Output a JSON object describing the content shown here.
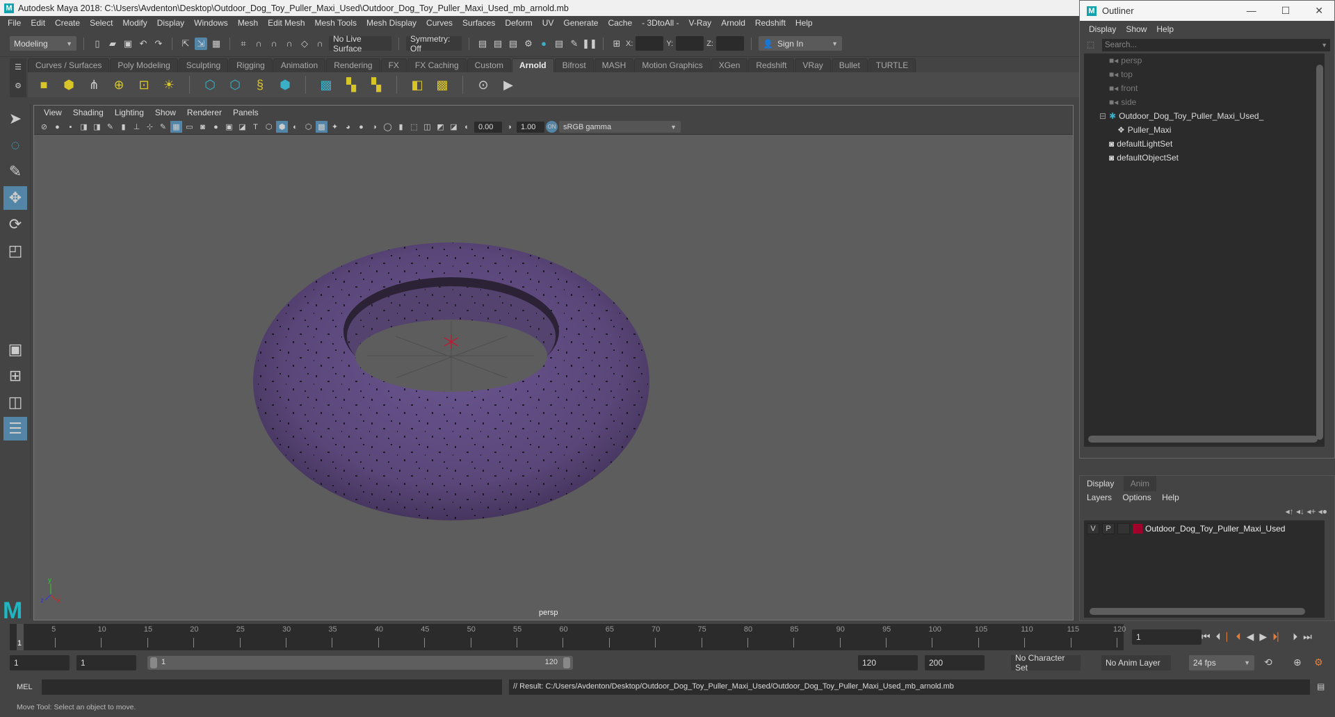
{
  "window": {
    "title": "Autodesk Maya 2018: C:\\Users\\Avdenton\\Desktop\\Outdoor_Dog_Toy_Puller_Maxi_Used\\Outdoor_Dog_Toy_Puller_Maxi_Used_mb_arnold.mb",
    "logo_letter": "M"
  },
  "menubar": [
    "File",
    "Edit",
    "Create",
    "Select",
    "Modify",
    "Display",
    "Windows",
    "Mesh",
    "Edit Mesh",
    "Mesh Tools",
    "Mesh Display",
    "Curves",
    "Surfaces",
    "Deform",
    "UV",
    "Generate",
    "Cache",
    "- 3DtoAll -",
    "V-Ray",
    "Arnold",
    "Redshift",
    "Help"
  ],
  "statusline": {
    "menuset": "Modeling",
    "live_surface": "No Live Surface",
    "symmetry": "Symmetry: Off",
    "x_label": "X:",
    "y_label": "Y:",
    "z_label": "Z:",
    "sign_in": "Sign In"
  },
  "shelf": {
    "tabs": [
      "Curves / Surfaces",
      "Poly Modeling",
      "Sculpting",
      "Rigging",
      "Animation",
      "Rendering",
      "FX",
      "FX Caching",
      "Custom",
      "Arnold",
      "Bifrost",
      "MASH",
      "Motion Graphics",
      "XGen",
      "Redshift",
      "VRay",
      "Bullet",
      "TURTLE"
    ],
    "active_tab": "Arnold"
  },
  "viewport": {
    "menu": [
      "View",
      "Shading",
      "Lighting",
      "Show",
      "Renderer",
      "Panels"
    ],
    "exposure": "0.00",
    "gamma": "1.00",
    "color_space": "sRGB gamma",
    "camera_label": "persp",
    "axis": {
      "x": "x",
      "y": "y",
      "z": "z"
    }
  },
  "outliner": {
    "title": "Outliner",
    "menu": [
      "Display",
      "Show",
      "Help"
    ],
    "search_placeholder": "Search...",
    "items": [
      {
        "label": "persp",
        "type": "camera"
      },
      {
        "label": "top",
        "type": "camera"
      },
      {
        "label": "front",
        "type": "camera"
      },
      {
        "label": "side",
        "type": "camera"
      },
      {
        "label": "Outdoor_Dog_Toy_Puller_Maxi_Used_",
        "type": "group"
      },
      {
        "label": "Puller_Maxi",
        "type": "mesh"
      },
      {
        "label": "defaultLightSet",
        "type": "set"
      },
      {
        "label": "defaultObjectSet",
        "type": "set"
      }
    ]
  },
  "layer_editor": {
    "tabs": [
      "Display",
      "Anim"
    ],
    "active_tab": "Display",
    "menu": [
      "Layers",
      "Options",
      "Help"
    ],
    "layers": [
      {
        "v": "V",
        "p": "P",
        "name": "Outdoor_Dog_Toy_Puller_Maxi_Used",
        "color": "#a0002a"
      }
    ]
  },
  "timeline": {
    "ticks": [
      5,
      10,
      15,
      20,
      25,
      30,
      35,
      40,
      45,
      50,
      55,
      60,
      65,
      70,
      75,
      80,
      85,
      90,
      95,
      100,
      105,
      110,
      115,
      120
    ],
    "current_frame": "1",
    "current_frame_field": "1",
    "range_start": 1,
    "range_end": 120
  },
  "range": {
    "start": "1",
    "playback_start": "1",
    "slider_start": "1",
    "slider_end": "120",
    "playback_end": "120",
    "end": "200",
    "character_set": "No Character Set",
    "anim_layer": "No Anim Layer",
    "fps": "24 fps"
  },
  "command": {
    "lang": "MEL",
    "result": "// Result: C:/Users/Avdenton/Desktop/Outdoor_Dog_Toy_Puller_Maxi_Used/Outdoor_Dog_Toy_Puller_Maxi_Used_mb_arnold.mb"
  },
  "help_line": "Move Tool: Select an object to move.",
  "colors": {
    "accent": "#5285a6",
    "maya_cyan": "#1fb6c2",
    "torus": "#5a4678",
    "layer": "#a0002a"
  }
}
